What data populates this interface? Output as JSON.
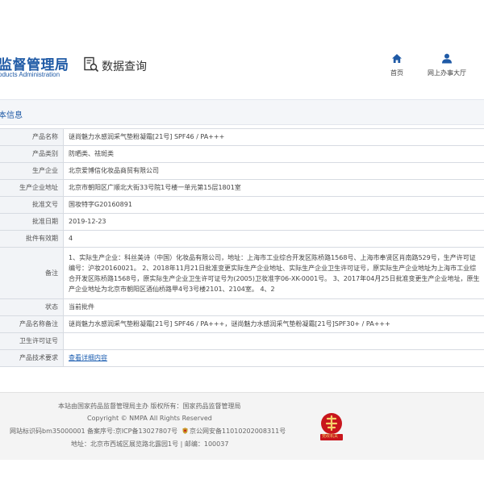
{
  "header": {
    "site_title": "监督管理局",
    "site_subtitle": "oducts Administration",
    "search_label": "数据查询",
    "nav": [
      {
        "label": "首页",
        "icon": "home-icon"
      },
      {
        "label": "网上办事大厅",
        "icon": "user-icon"
      }
    ]
  },
  "section": {
    "title": "本信息"
  },
  "details": {
    "product_name": {
      "label": "产品名称",
      "value": "谜尚魅力水感润采气垫粉凝霜[21号] SPF46 / PA+++"
    },
    "product_category": {
      "label": "产品类别",
      "value": "防晒类、祛斑类"
    },
    "manufacturer": {
      "label": "生产企业",
      "value": "北京爱博信化妆品商贸有限公司"
    },
    "manufacturer_address": {
      "label": "生产企业地址",
      "value": "北京市朝阳区广顺北大街33号院1号楼一单元第15层1801室"
    },
    "approval_number": {
      "label": "批准文号",
      "value": "国妆特字G20160891"
    },
    "approval_date": {
      "label": "批准日期",
      "value": "2019-12-23"
    },
    "validity": {
      "label": "批件有效期",
      "value": "4"
    },
    "remarks": {
      "label": "备注",
      "value": "1、实际生产企业：科丝美诗（中国）化妆品有限公司，地址：上海市工业综合开发区陈桥路1568号、上海市奉贤区肖南路529号，生产许可证编号：沪妆20160021。 2、2018年11月21日批准变更实际生产企业地址、实际生产企业卫生许可证号，原实际生产企业地址为上海市工业综合开发区陈桥路1568号，原实际生产企业卫生许可证号为(2005)卫妆准字06-XK-0001号。 3、2017年04月25日批准变更生产企业地址，原生产企业地址为北京市朝阳区酒仙桥路甲4号3号楼2101、2104室。 4、2"
    },
    "status": {
      "label": "状态",
      "value": "当前批件"
    },
    "product_name_notes": {
      "label": "产品名称备注",
      "value": "谜尚魅力水感润采气垫粉凝霜[21号] SPF46 / PA+++，谜尚魅力水感润采气垫粉凝霜[21号]SPF30+ / PA+++"
    },
    "health_license": {
      "label": "卫生许可证号",
      "value": ""
    },
    "tech_requirements": {
      "label": "产品技术要求",
      "value": "查看详细内容"
    }
  },
  "footer": {
    "sponsor": "本站由国家药品监督管理局主办 版权所有：国家药品监督管理局",
    "copyright": "Copyright © NMPA All Rights Reserved",
    "site_id": "网站标识码bm35000001",
    "icp": "备案序号:京ICP备13027807号",
    "police": "京公网安备11010202008311号",
    "address": "地址：北京市西城区展览路北露园1号 | 邮编：100037",
    "badge_text": "党政机关"
  },
  "colors": {
    "brand_blue": "#1f5aa6",
    "link_blue": "#1a5cb0",
    "badge_red": "#c8161d"
  }
}
